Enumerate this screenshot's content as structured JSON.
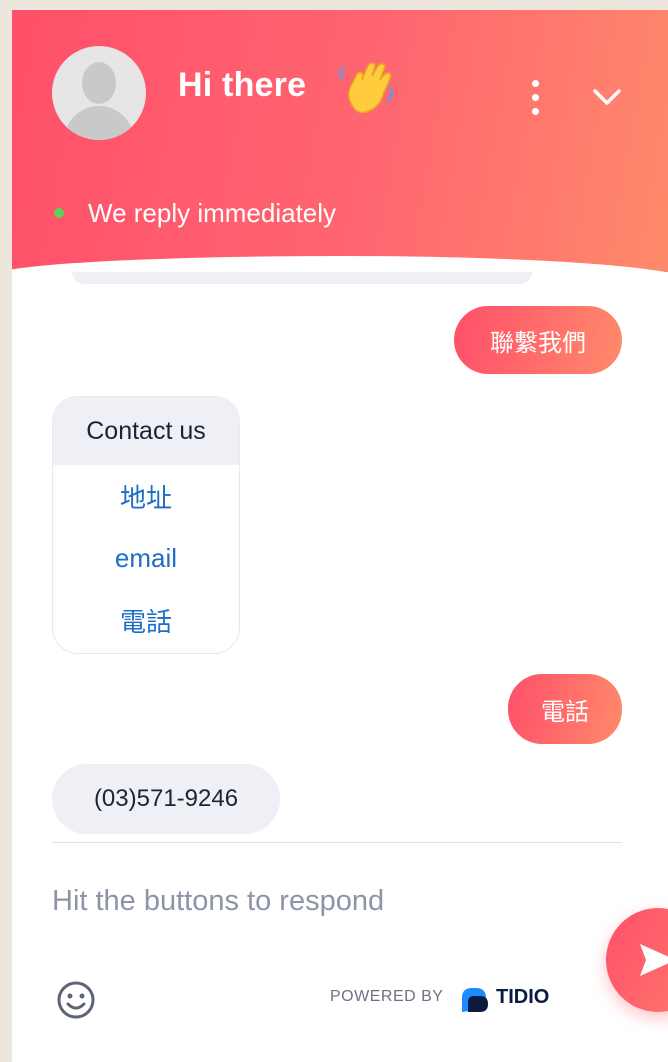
{
  "header": {
    "title": "Hi there",
    "wave_emoji": "waving-hand-icon",
    "status": "We reply immediately",
    "status_color": "#5bd35b",
    "gradient": [
      "#ff4f6a",
      "#ff8a6b"
    ]
  },
  "messages": {
    "user_1": "聯繫我們",
    "card": {
      "title": "Contact us",
      "buttons": [
        "地址",
        "email",
        "電話"
      ]
    },
    "user_2": "電話",
    "bot_reply": "(03)571-9246"
  },
  "composer": {
    "placeholder": "Hit the buttons to respond",
    "powered_by": "POWERED BY",
    "brand": "TIDIO"
  },
  "icons": {
    "menu": "more-vertical-icon",
    "collapse": "chevron-down-icon",
    "emoji": "emoji-smile-icon",
    "send": "send-icon",
    "avatar": "user-avatar-icon"
  },
  "colors": {
    "accent": "#ff5a6e",
    "link": "#1e6ec8",
    "bubble_bot": "#eef0f6"
  }
}
